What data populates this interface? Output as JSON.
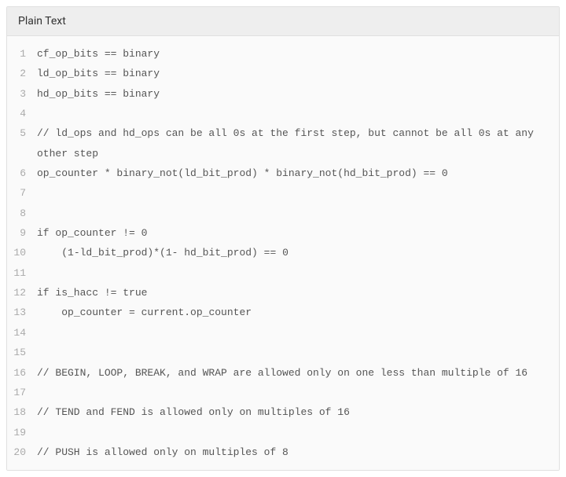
{
  "header": {
    "title": "Plain Text"
  },
  "code": {
    "lines": [
      {
        "num": "1",
        "text": "cf_op_bits == binary"
      },
      {
        "num": "2",
        "text": "ld_op_bits == binary"
      },
      {
        "num": "3",
        "text": "hd_op_bits == binary"
      },
      {
        "num": "4",
        "text": ""
      },
      {
        "num": "5",
        "text": "// ld_ops and hd_ops can be all 0s at the first step, but cannot be all 0s at any other step"
      },
      {
        "num": "6",
        "text": "op_counter * binary_not(ld_bit_prod) * binary_not(hd_bit_prod) == 0"
      },
      {
        "num": "7",
        "text": ""
      },
      {
        "num": "8",
        "text": ""
      },
      {
        "num": "9",
        "text": "if op_counter != 0"
      },
      {
        "num": "10",
        "text": "    (1-ld_bit_prod)*(1- hd_bit_prod) == 0"
      },
      {
        "num": "11",
        "text": ""
      },
      {
        "num": "12",
        "text": "if is_hacc != true"
      },
      {
        "num": "13",
        "text": "    op_counter = current.op_counter"
      },
      {
        "num": "14",
        "text": ""
      },
      {
        "num": "15",
        "text": ""
      },
      {
        "num": "16",
        "text": "// BEGIN, LOOP, BREAK, and WRAP are allowed only on one less than multiple of 16"
      },
      {
        "num": "17",
        "text": ""
      },
      {
        "num": "18",
        "text": "// TEND and FEND is allowed only on multiples of 16"
      },
      {
        "num": "19",
        "text": ""
      },
      {
        "num": "20",
        "text": "// PUSH is allowed only on multiples of 8"
      }
    ]
  }
}
